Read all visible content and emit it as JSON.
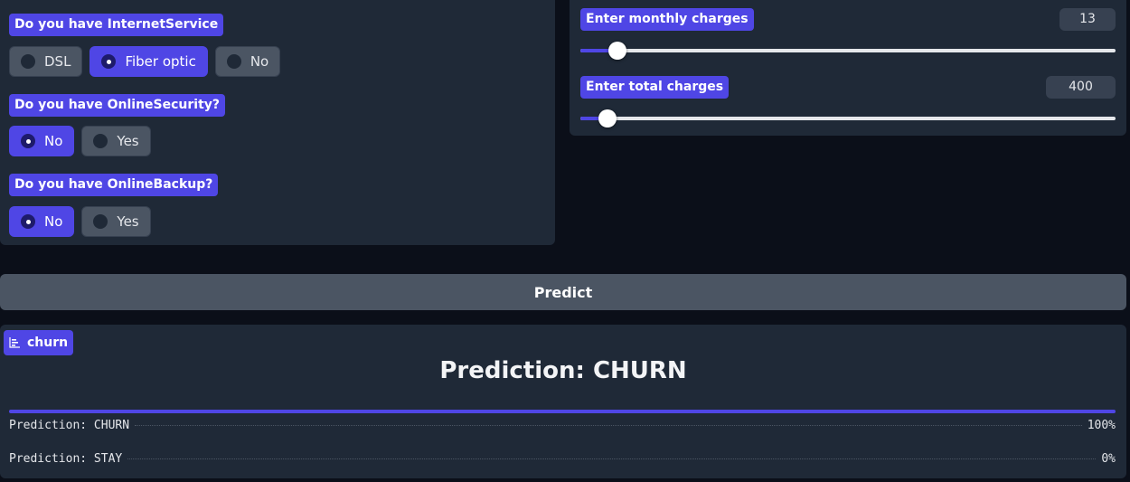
{
  "left": {
    "internet": {
      "question": "Do you have InternetService",
      "options": [
        "DSL",
        "Fiber optic",
        "No"
      ],
      "selected": "Fiber optic"
    },
    "security": {
      "question": "Do you have OnlineSecurity?",
      "options": [
        "No",
        "Yes"
      ],
      "selected": "No"
    },
    "backup": {
      "question": "Do you have OnlineBackup?",
      "options": [
        "No",
        "Yes"
      ],
      "selected": "No"
    }
  },
  "right": {
    "monthly": {
      "label": "Enter monthly charges",
      "value": "13",
      "level": 0.07
    },
    "total": {
      "label": "Enter total charges",
      "value": "400",
      "level": 0.05
    }
  },
  "predict_label": "Predict",
  "output": {
    "label": "churn",
    "heading": "Prediction: CHURN",
    "rows": [
      {
        "name": "Prediction: CHURN",
        "value": "100%"
      },
      {
        "name": "Prediction: STAY",
        "value": "0%"
      }
    ]
  },
  "colors": {
    "accent": "#4f46e5",
    "panel": "#1f2937",
    "background": "#0b0f19"
  }
}
